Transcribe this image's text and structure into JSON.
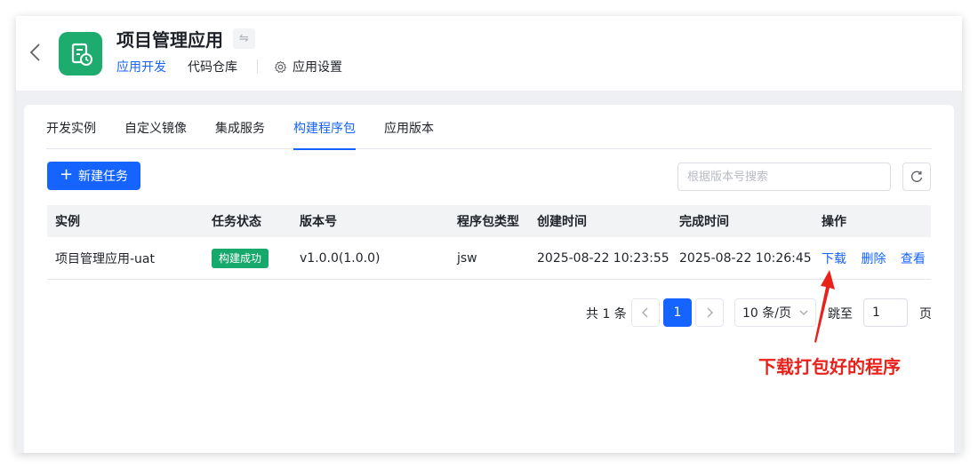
{
  "header": {
    "app_title": "项目管理应用",
    "switch_icon": "swap-icon",
    "nav": {
      "dev": "应用开发",
      "repo": "代码仓库",
      "settings": "应用设置"
    }
  },
  "tabs": [
    {
      "label": "开发实例"
    },
    {
      "label": "自定义镜像"
    },
    {
      "label": "集成服务"
    },
    {
      "label": "构建程序包",
      "active": true
    },
    {
      "label": "应用版本"
    }
  ],
  "toolbar": {
    "new_task": "新建任务",
    "search_placeholder": "根据版本号搜索"
  },
  "table": {
    "columns": [
      "实例",
      "任务状态",
      "版本号",
      "程序包类型",
      "创建时间",
      "完成时间",
      "操作"
    ],
    "rows": [
      {
        "instance": "项目管理应用-uat",
        "status": "构建成功",
        "version": "v1.0.0(1.0.0)",
        "package_type": "jsw",
        "created": "2025-08-22 10:23:55",
        "finished": "2025-08-22 10:26:45",
        "actions": [
          "下载",
          "删除",
          "查看"
        ]
      }
    ]
  },
  "pagination": {
    "total": "共 1 条",
    "current_page": "1",
    "page_size": "10 条/页",
    "jump_label": "跳至",
    "jump_value": "1",
    "page_suffix": "页"
  },
  "annotation": {
    "text": "下载打包好的程序",
    "color": "#e8211a"
  },
  "colors": {
    "primary": "#1664ff",
    "success": "#17a86c",
    "app_icon": "#1eab6e"
  }
}
